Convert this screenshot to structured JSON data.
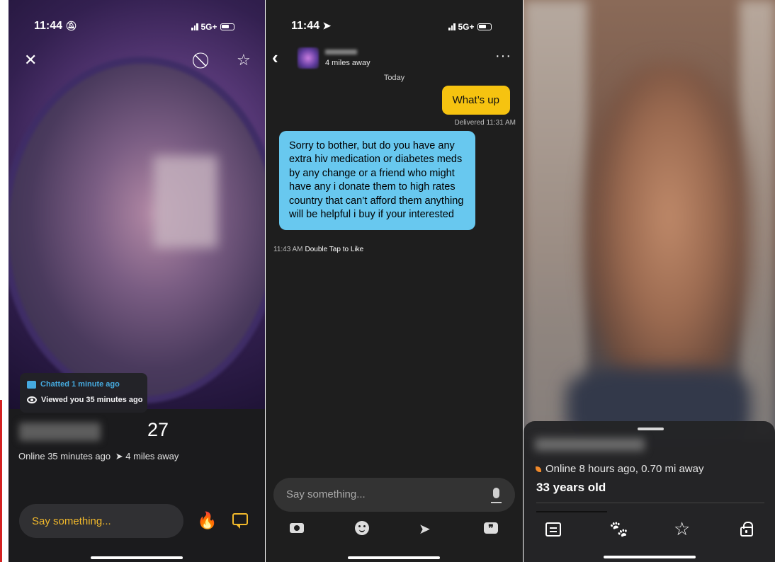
{
  "panel1": {
    "status_time": "11:44",
    "network": "5G+",
    "tooltip": {
      "chatted": "Chatted 1 minute ago",
      "viewed": "Viewed you 35 minutes ago"
    },
    "age": "27",
    "online": "Online 35 minutes ago",
    "distance": "4 miles away",
    "input_placeholder": "Say something..."
  },
  "panel2": {
    "status_time": "11:44",
    "network": "5G+",
    "header": {
      "distance": "4 miles away"
    },
    "date_divider": "Today",
    "messages": [
      {
        "from": "me",
        "text": "What’s up",
        "status": "Delivered 11:31 AM"
      },
      {
        "from": "them",
        "text": "Sorry to bother, but do you have any extra hiv medication or diabetes meds by any change or a friend who might have any i donate them to high rates country that can’t afford them anything will be helpful i buy if your interested",
        "time": "11:43 AM",
        "hint": "Double Tap to Like"
      }
    ],
    "input_placeholder": "Say something..."
  },
  "panel3": {
    "online": "Online 8 hours ago, 0.70 mi away",
    "age": "33 years old"
  },
  "colors": {
    "accent_yellow": "#f6c310",
    "bubble_blue": "#68c8ef",
    "orange": "#f2b92b"
  }
}
